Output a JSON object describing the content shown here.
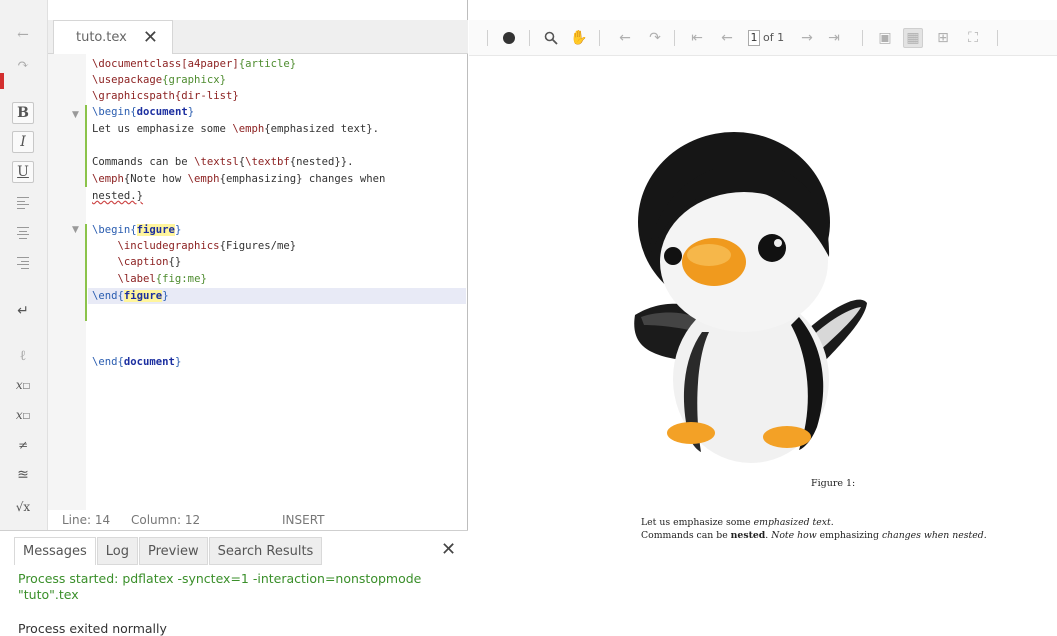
{
  "editor": {
    "tab": {
      "label": "tuto.tex",
      "close": "✕"
    },
    "code": {
      "l1_cmd": "\\documentclass",
      "l1_opt": "[a4paper]",
      "l1_arg": "{article}",
      "l2_cmd": "\\usepackage",
      "l2_arg": "{graphicx}",
      "l3_cmd": "\\graphicspath",
      "l3_arg": "{dir-list}",
      "l4_cmd": "\\begin",
      "l4_env": "document",
      "l5_a": "Let us emphasize some ",
      "l5_cmd": "\\emph",
      "l5_b": "{emphasized text}.",
      "l7_a": "Commands can be ",
      "l7_cmd1": "\\textsl",
      "l7_b": "{",
      "l7_cmd2": "\\textbf",
      "l7_c": "{nested}}.",
      "l8_cmd1": "\\emph",
      "l8_a": "{Note how ",
      "l8_cmd2": "\\emph",
      "l8_b": "{emphasizing} changes when",
      "l9": "nested.}",
      "l11_cmd": "\\begin",
      "l11_env": "figure",
      "l12_cmd": "\\includegraphics",
      "l12_arg": "{Figures/me}",
      "l13_cmd": "\\caption",
      "l13_arg": "{}",
      "l14_cmd": "\\label",
      "l14_arg": "{fig:me}",
      "l15_cmd": "\\end",
      "l15_env": "figure",
      "l18_cmd": "\\end",
      "l18_env": "document"
    },
    "status": {
      "line": "Line: 14",
      "column": "Column: 12",
      "mode": "INSERT"
    }
  },
  "messages": {
    "tabs": [
      "Messages",
      "Log",
      "Preview",
      "Search Results"
    ],
    "close": "✕",
    "lines": [
      "Process started: pdflatex -synctex=1 -interaction=nonstopmode",
      "\"tuto\".tex",
      "Process exited normally"
    ]
  },
  "pdf": {
    "page_current": "1",
    "page_of": "of 1",
    "caption": "Figure 1:",
    "body_line1_a": "Let us emphasize some ",
    "body_line1_b": "emphasized text",
    "body_line1_c": ".",
    "body_line2_a": "Commands can be ",
    "body_line2_b": "nested",
    "body_line2_c": ". ",
    "body_line2_d": "Note how ",
    "body_line2_e": "emphasizing",
    "body_line2_f": " changes when nested."
  },
  "colors": {
    "latex_command": "#8b1f1f",
    "latex_argument": "#4e8c2f",
    "latex_env_highlight": "#fff59d",
    "messages_text": "#3a8f2a"
  }
}
